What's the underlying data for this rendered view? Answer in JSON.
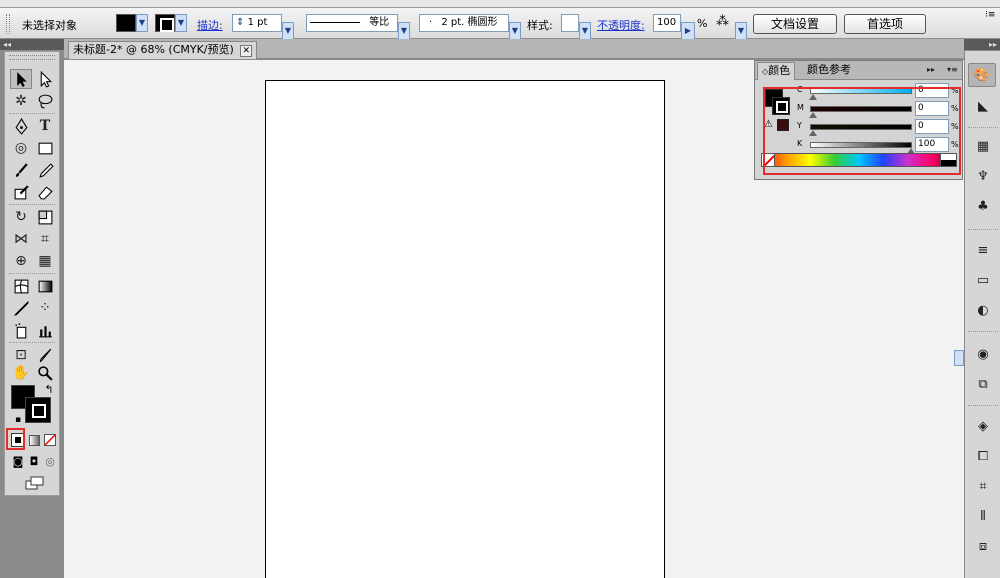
{
  "control_bar": {
    "selection_label": "未选择对象",
    "stroke_label": "描边:",
    "stroke_weight": "1 pt",
    "stroke_profile": "等比",
    "brush_label": "2 pt. 椭圆形",
    "style_label": "样式:",
    "opacity_label": "不透明度:",
    "opacity_value": "100",
    "opacity_unit": "%",
    "doc_setup_button": "文档设置",
    "preferences_button": "首选项"
  },
  "document": {
    "tab_title": "未标题-2* @ 68% (CMYK/预览)",
    "close_glyph": "✕"
  },
  "color_panel": {
    "tab_color": "颜色",
    "tab_color_guide": "颜色参考",
    "channels": [
      {
        "label": "C",
        "value": "0",
        "unit": "%"
      },
      {
        "label": "M",
        "value": "0",
        "unit": "%"
      },
      {
        "label": "Y",
        "value": "0",
        "unit": "%"
      },
      {
        "label": "K",
        "value": "100",
        "unit": "%"
      }
    ]
  },
  "colors": {
    "highlight": "#e32c2c",
    "link": "#1a33c8",
    "artboard": "#ffffff"
  }
}
